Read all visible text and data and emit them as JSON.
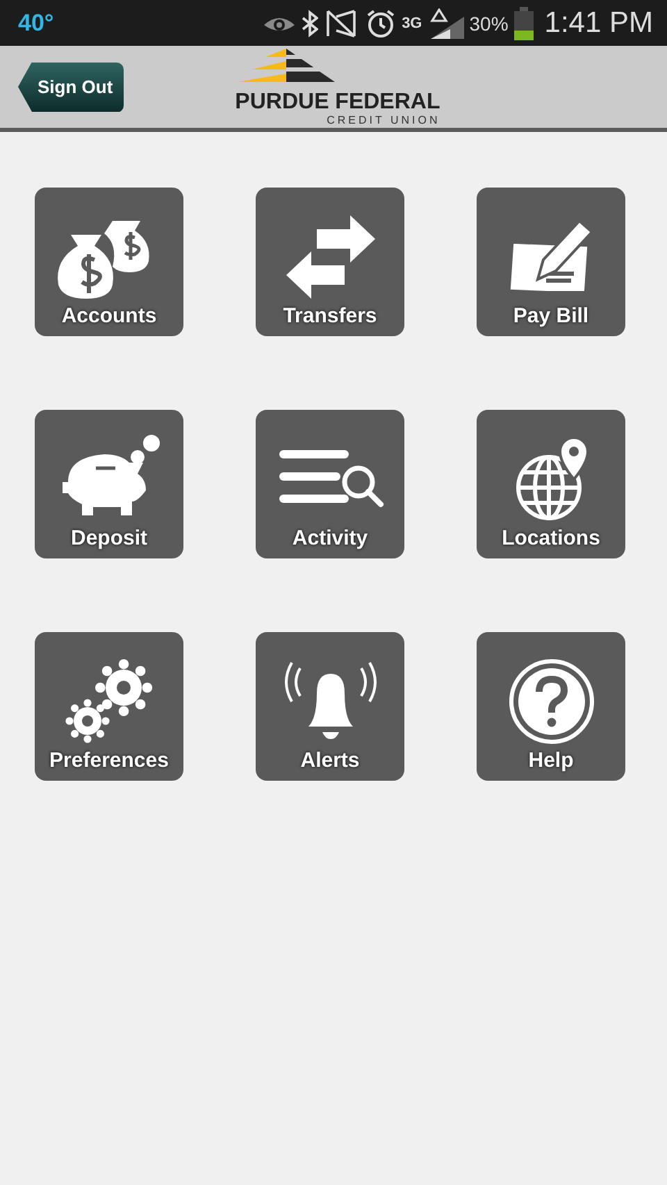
{
  "status_bar": {
    "temperature": "40°",
    "network": "3G",
    "battery": "30%",
    "time": "1:41 PM"
  },
  "header": {
    "sign_out": "Sign Out",
    "logo_name": "PURDUE FEDERAL",
    "logo_sub": "CREDIT UNION"
  },
  "tiles": [
    {
      "label": "Accounts",
      "kind": "money-bags"
    },
    {
      "label": "Transfers",
      "kind": "arrows"
    },
    {
      "label": "Pay Bill",
      "kind": "check-pen"
    },
    {
      "label": "Deposit",
      "kind": "piggy"
    },
    {
      "label": "Activity",
      "kind": "list-search"
    },
    {
      "label": "Locations",
      "kind": "globe-pin"
    },
    {
      "label": "Preferences",
      "kind": "gears"
    },
    {
      "label": "Alerts",
      "kind": "bell"
    },
    {
      "label": "Help",
      "kind": "help"
    }
  ]
}
